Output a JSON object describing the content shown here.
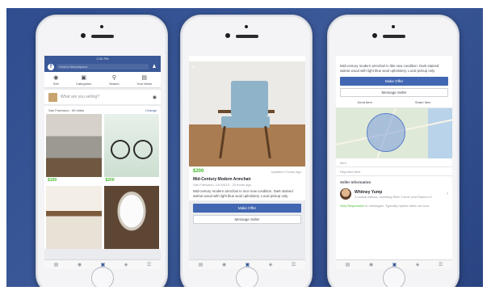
{
  "phone1": {
    "status_time": "2:20 PM",
    "search_placeholder": "Search Marketplace",
    "actions": [
      {
        "label": "Sell",
        "icon": "camera-icon"
      },
      {
        "label": "Categories",
        "icon": "bag-icon"
      },
      {
        "label": "Search",
        "icon": "search-icon"
      },
      {
        "label": "Your Items",
        "icon": "box-icon"
      }
    ],
    "composer_placeholder": "What are you selling?",
    "location": "San Francisco · 60 miles",
    "change_label": "Change",
    "listings": [
      {
        "price": "$150"
      },
      {
        "price": "$200"
      },
      {
        "price": ""
      },
      {
        "price": ""
      }
    ]
  },
  "phone2": {
    "price": "$200",
    "posted": "Updated 2 hours ago",
    "title": "Mid-Century Modern Armchair",
    "meta": "San Francisco, CA 94110 · 20 hours ago",
    "description": "Mid-century modern armchair in nice new condition. Dark stained walnut wood with light blue wool upholstery. Local pickup only.",
    "make_offer": "Make Offer",
    "message_seller": "Message Seller"
  },
  "phone3": {
    "description": "Mid-century modern armchair in like new condition. Dark stained walnut wood with light blue wool upholstery. Local pickup only.",
    "make_offer": "Make Offer",
    "message_seller": "Message Seller",
    "send_item": "Send Item",
    "share_item": "Share Item",
    "field1": "Item",
    "field2": "Reported Item",
    "section_seller": "Seller Information",
    "seller_name": "Whitney Yump",
    "seller_mutual": "2 mutual friends, including Ellen Turner and Rashmi G.",
    "responsive_label": "Very Responsive",
    "responsive_text": "to messages. Typically replies within an hour."
  },
  "colors": {
    "brand": "#3b5998",
    "price_green": "#42b72a",
    "button_blue": "#4267b2"
  }
}
